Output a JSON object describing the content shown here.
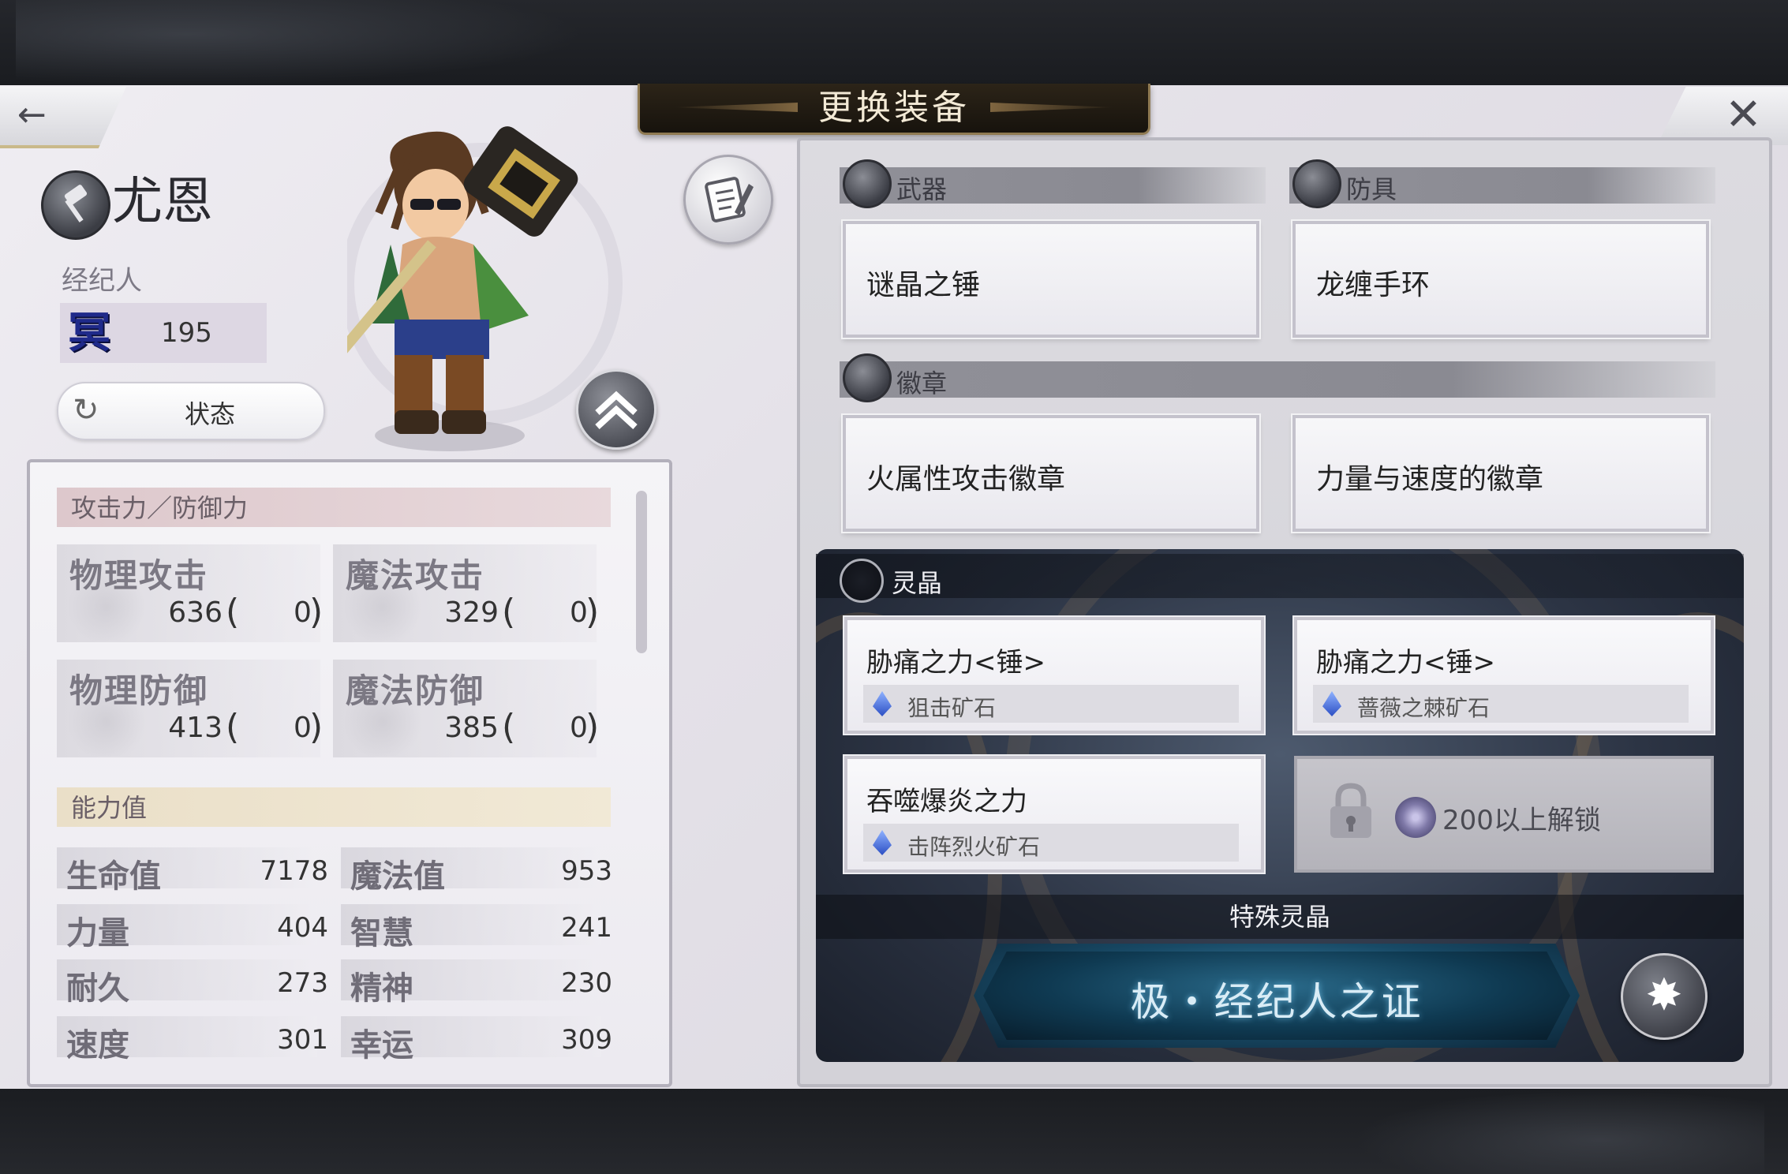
{
  "header": {
    "title": "更换装备"
  },
  "nav": {
    "back_icon": "back-arrow-icon",
    "close_icon": "close-icon"
  },
  "character": {
    "name": "尤恩",
    "class_icon": "hammer-class-icon",
    "role_label": "经纪人",
    "level_glyph": "冥",
    "level": "195",
    "status_button": "状态"
  },
  "stats": {
    "attack_section": "攻击力／防御力",
    "attack": [
      {
        "name": "物理攻击",
        "value": "636",
        "bonus": "0"
      },
      {
        "name": "魔法攻击",
        "value": "329",
        "bonus": "0"
      },
      {
        "name": "物理防御",
        "value": "413",
        "bonus": "0"
      },
      {
        "name": "魔法防御",
        "value": "385",
        "bonus": "0"
      }
    ],
    "ability_section": "能力值",
    "abilities": [
      {
        "name": "生命值",
        "value": "7178"
      },
      {
        "name": "魔法值",
        "value": "953"
      },
      {
        "name": "力量",
        "value": "404"
      },
      {
        "name": "智慧",
        "value": "241"
      },
      {
        "name": "耐久",
        "value": "273"
      },
      {
        "name": "精神",
        "value": "230"
      },
      {
        "name": "速度",
        "value": "301"
      },
      {
        "name": "幸运",
        "value": "309"
      }
    ]
  },
  "equipment": {
    "weapon_label": "武器",
    "armor_label": "防具",
    "weapon": "谜晶之锤",
    "armor": "龙缠手环",
    "badge_label": "徽章",
    "badges": [
      "火属性攻击徽章",
      "力量与速度的徽章"
    ]
  },
  "runes": {
    "label": "灵晶",
    "slots": [
      {
        "name": "胁痛之力<锤>",
        "ore": "狙击矿石"
      },
      {
        "name": "胁痛之力<锤>",
        "ore": "蔷薇之棘矿石"
      },
      {
        "name": "吞噬爆炎之力",
        "ore": "击阵烈火矿石"
      }
    ],
    "locked_text": "200以上解锁",
    "special_label": "特殊灵晶",
    "special_button": "极・经纪人之证"
  },
  "colors": {
    "accent_gold": "#c9b98a",
    "level_blue": "#1f2a8a",
    "rune_blue": "#2a6a8a"
  }
}
